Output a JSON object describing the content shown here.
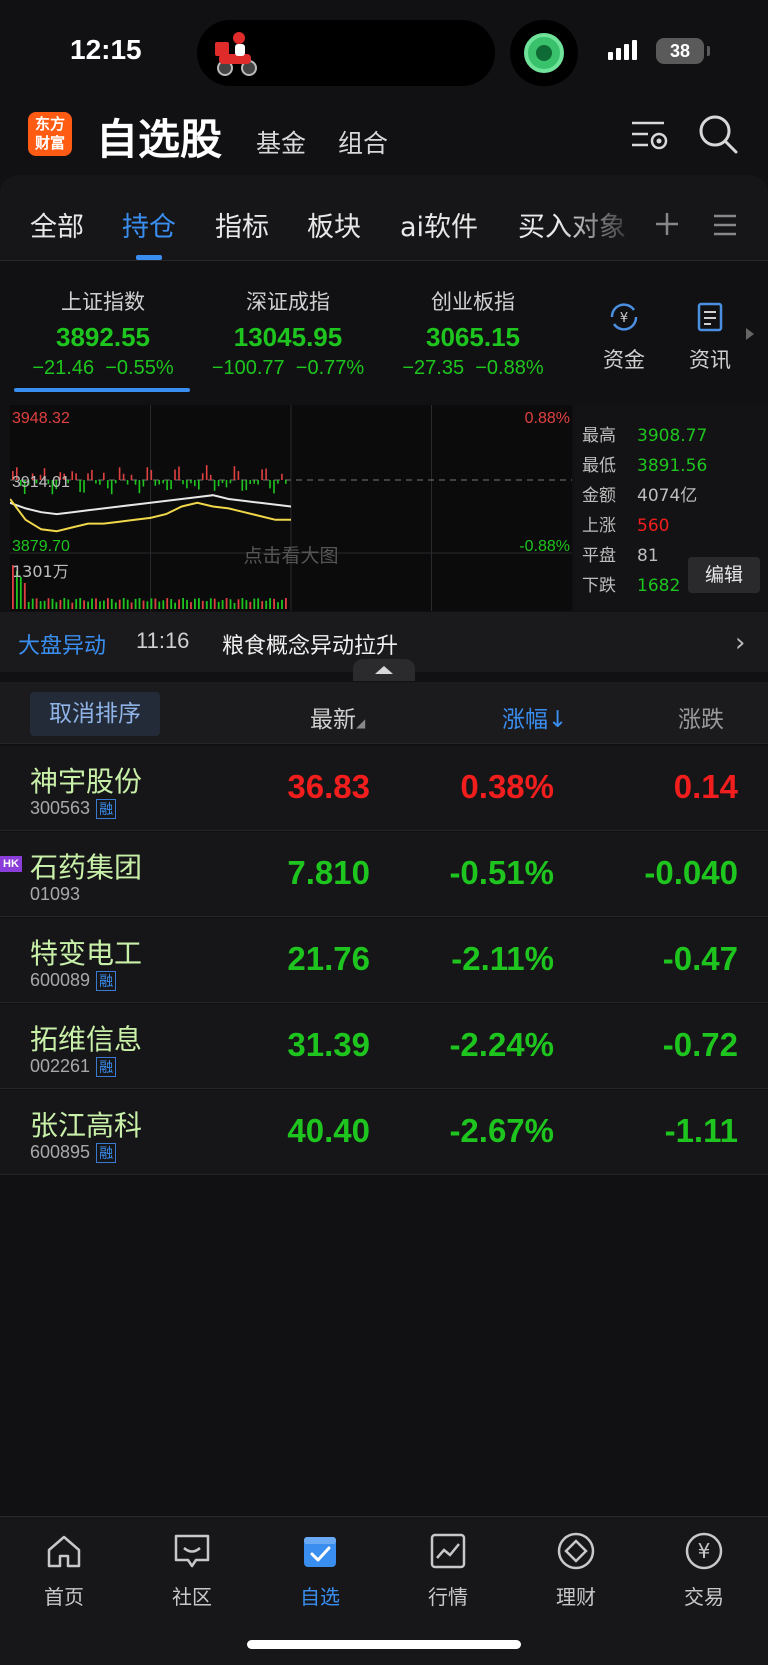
{
  "status": {
    "time": "12:15",
    "battery": "38"
  },
  "header": {
    "logo": "东方财富",
    "logo_l1": "东方",
    "logo_l2": "财富",
    "title": "自选股",
    "tab_fund": "基金",
    "tab_portfolio": "组合"
  },
  "tabs": [
    "全部",
    "持仓",
    "指标",
    "板块",
    "ai软件",
    "买入对象"
  ],
  "tabs_active": 1,
  "indices": [
    {
      "name": "上证指数",
      "value": "3892.55",
      "change": "−21.46",
      "pct": "−0.55%"
    },
    {
      "name": "深证成指",
      "value": "13045.95",
      "change": "−100.77",
      "pct": "−0.77%"
    },
    {
      "name": "创业板指",
      "value": "3065.15",
      "change": "−27.35",
      "pct": "−0.88%"
    }
  ],
  "side_buttons": {
    "funds": "资金",
    "news": "资讯"
  },
  "chart": {
    "high_label": "3948.32",
    "mid_label": "3914.01",
    "low_label": "3879.70",
    "pct_up": "0.88%",
    "pct_down": "-0.88%",
    "volume_label": "1301万",
    "hint": "点击看大图"
  },
  "chart_data": {
    "type": "line",
    "ylim": [
      3879.7,
      3948.32
    ],
    "prev_close": 3914.01,
    "series": [],
    "white_line": [
      3902,
      3899,
      3897,
      3896,
      3897,
      3898,
      3899,
      3900,
      3901,
      3902,
      3903,
      3904,
      3905,
      3906,
      3904,
      3903,
      3902,
      3901,
      3900
    ],
    "yellow_line": [
      3904,
      3893,
      3888,
      3887,
      3889,
      3891,
      3891,
      3892,
      3893,
      3894,
      3896,
      3900,
      3902,
      3900,
      3899,
      3897,
      3895,
      3893,
      3893
    ]
  },
  "stats": [
    {
      "label": "最高",
      "value": "3908.77",
      "color": "#1ec51e"
    },
    {
      "label": "最低",
      "value": "3891.56",
      "color": "#1ec51e"
    },
    {
      "label": "金额",
      "value": "4074亿",
      "color": "#bdbdbd"
    },
    {
      "label": "上涨",
      "value": "560",
      "color": "#f21d1d"
    },
    {
      "label": "平盘",
      "value": "81",
      "color": "#bdbdbd"
    },
    {
      "label": "下跌",
      "value": "1682",
      "color": "#1ec51e"
    }
  ],
  "edit_label": "编辑",
  "ticker": {
    "label": "大盘异动",
    "time": "11:16",
    "text": "粮食概念异动拉升"
  },
  "list_header": {
    "sort_btn": "取消排序",
    "col_latest": "最新",
    "col_pct": "涨幅↓",
    "col_change": "涨跌"
  },
  "stocks": [
    {
      "name": "神宇股份",
      "code": "300563",
      "badge": "融",
      "price": "36.83",
      "pct": "0.38%",
      "change": "0.14",
      "up": true,
      "hk": false
    },
    {
      "name": "石药集团",
      "code": "01093",
      "badge": "",
      "price": "7.810",
      "pct": "-0.51%",
      "change": "-0.040",
      "up": false,
      "hk": true
    },
    {
      "name": "特变电工",
      "code": "600089",
      "badge": "融",
      "price": "21.76",
      "pct": "-2.11%",
      "change": "-0.47",
      "up": false,
      "hk": false
    },
    {
      "name": "拓维信息",
      "code": "002261",
      "badge": "融",
      "price": "31.39",
      "pct": "-2.24%",
      "change": "-0.72",
      "up": false,
      "hk": false
    },
    {
      "name": "张江高科",
      "code": "600895",
      "badge": "融",
      "price": "40.40",
      "pct": "-2.67%",
      "change": "-1.11",
      "up": false,
      "hk": false
    }
  ],
  "hk_label": "HK",
  "nav": [
    {
      "label": "首页",
      "icon": "home-icon"
    },
    {
      "label": "社区",
      "icon": "chat-icon"
    },
    {
      "label": "自选",
      "icon": "check-icon"
    },
    {
      "label": "行情",
      "icon": "chart-icon"
    },
    {
      "label": "理财",
      "icon": "diamond-icon"
    },
    {
      "label": "交易",
      "icon": "yen-icon"
    }
  ],
  "nav_active": 2
}
